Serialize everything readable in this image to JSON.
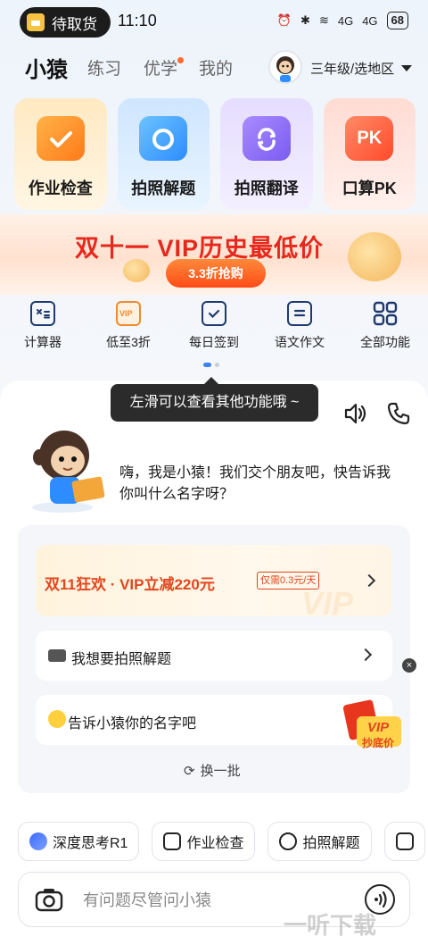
{
  "status_bar": {
    "pickup_label": "待取货",
    "time": "11:10",
    "signal_1": "4G",
    "signal_2": "4G",
    "battery": "68"
  },
  "header": {
    "tabs": [
      {
        "label": "小猿",
        "active": true
      },
      {
        "label": "练习",
        "active": false
      },
      {
        "label": "优学",
        "active": false,
        "badge": true
      },
      {
        "label": "我的",
        "active": false
      }
    ],
    "grade_selector": "三年级/选地区"
  },
  "features": [
    {
      "label": "作业检查",
      "icon": "check-icon"
    },
    {
      "label": "拍照解题",
      "icon": "camera-icon"
    },
    {
      "label": "拍照翻译",
      "icon": "translate-icon"
    },
    {
      "label": "口算PK",
      "icon": "pk-icon",
      "glyph": "PK"
    }
  ],
  "banner": {
    "title": "双十一 VIP历史最低价",
    "cta": "3.3折抢购"
  },
  "quick_links": [
    {
      "label": "计算器",
      "icon": "calculator-icon"
    },
    {
      "label": "低至3折",
      "icon": "vip-icon",
      "glyph": "VIP"
    },
    {
      "label": "每日签到",
      "icon": "calendar-check-icon"
    },
    {
      "label": "语文作文",
      "icon": "document-icon"
    },
    {
      "label": "全部功能",
      "icon": "grid-icon"
    }
  ],
  "tooltip": "左滑可以查看其他功能哦 ~",
  "chat": {
    "greeting": "嗨，我是小猿！我们交个朋友吧，快告诉我你叫什么名字呀？",
    "promo": {
      "text": "双11狂欢 · VIP立减220元",
      "tag": "仅需0.3元/天",
      "watermark": "VIP"
    },
    "suggestions": [
      {
        "text": "我想要拍照解题",
        "icon": "camera-icon"
      },
      {
        "text": "告诉小猿你的名字吧",
        "icon": "smile-icon"
      }
    ],
    "sticker": {
      "line1": "VIP",
      "line2": "抄底价"
    },
    "swap_label": "换一批",
    "close_glyph": "×"
  },
  "chips": [
    {
      "label": "深度思考R1",
      "icon": "deep-think-icon"
    },
    {
      "label": "作业检查",
      "icon": "check-doc-icon"
    },
    {
      "label": "拍照解题",
      "icon": "camera-icon"
    }
  ],
  "input": {
    "placeholder": "有问题尽管问小猿"
  },
  "watermark": "一听下载",
  "colors": {
    "accent": "#3b82f6",
    "promo_red": "#e2461d",
    "banner_red": "#e8271c"
  }
}
